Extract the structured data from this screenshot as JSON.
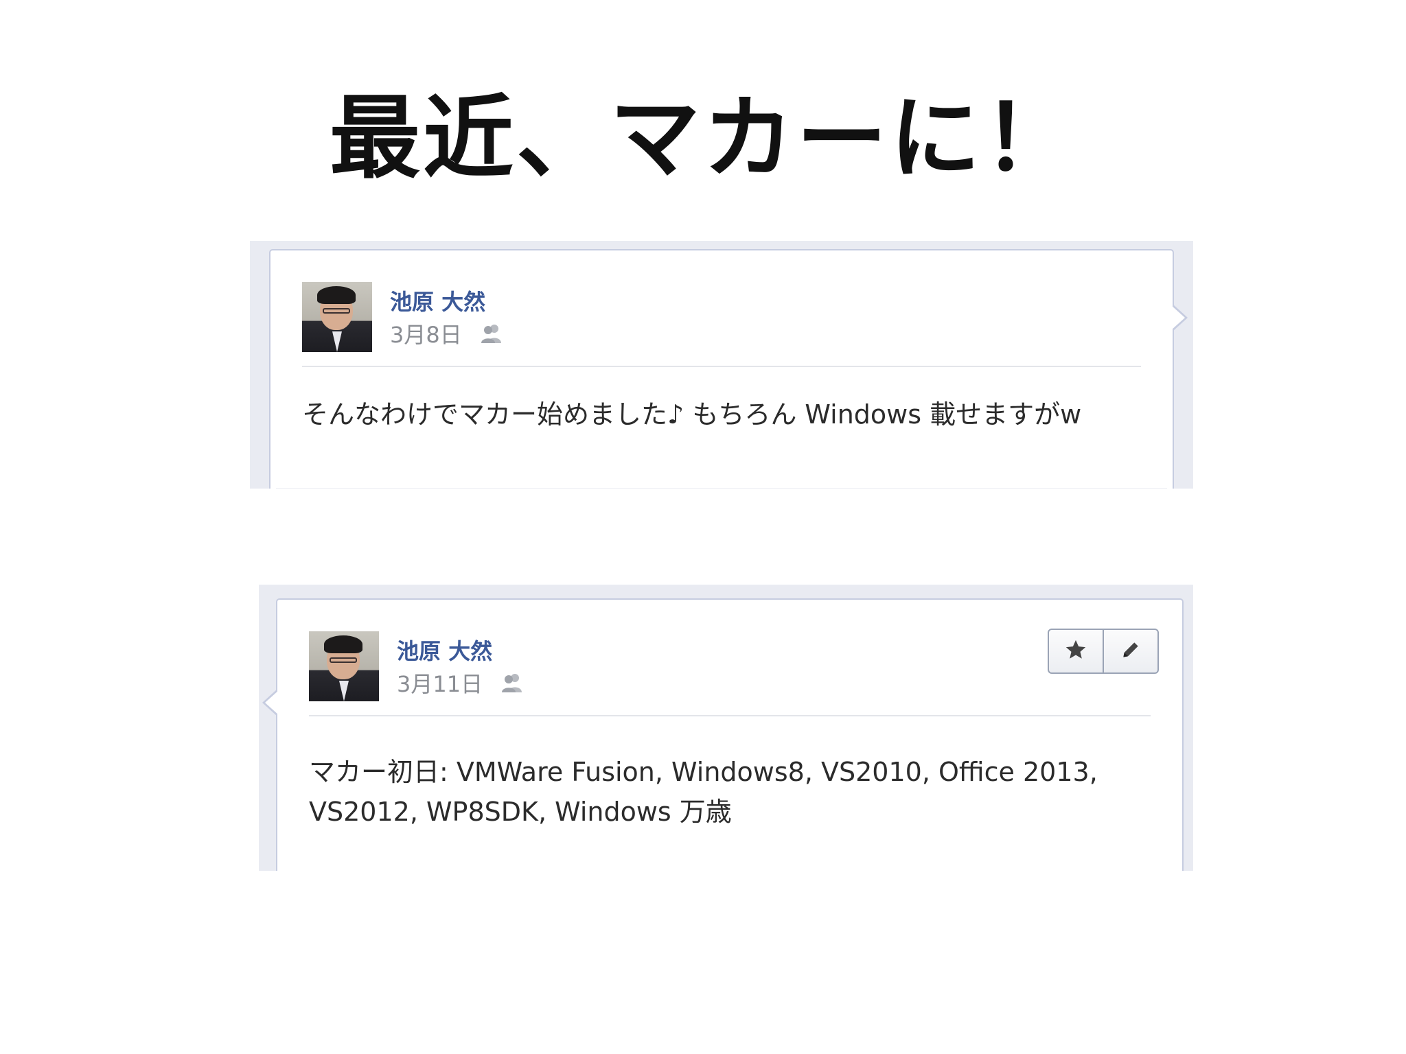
{
  "slide": {
    "title": "最近、マカーに！"
  },
  "posts": [
    {
      "author": "池原 大然",
      "date": "3月8日",
      "audience_icon": "friends-icon",
      "message": "そんなわけでマカー始めました♪ もちろん Windows 載せますがw"
    },
    {
      "author": "池原 大然",
      "date": "3月11日",
      "audience_icon": "friends-icon",
      "message": "マカー初日: VMWare Fusion, Windows8, VS2010, Office 2013,\nVS2012, WP8SDK, Windows 万歳",
      "actions": [
        "star-icon",
        "pencil-icon"
      ]
    }
  ],
  "colors": {
    "author_link": "#3b5998",
    "meta_text": "#8a8d93",
    "card_border": "#c6cce0",
    "frame_bg": "#e9ebf2"
  }
}
